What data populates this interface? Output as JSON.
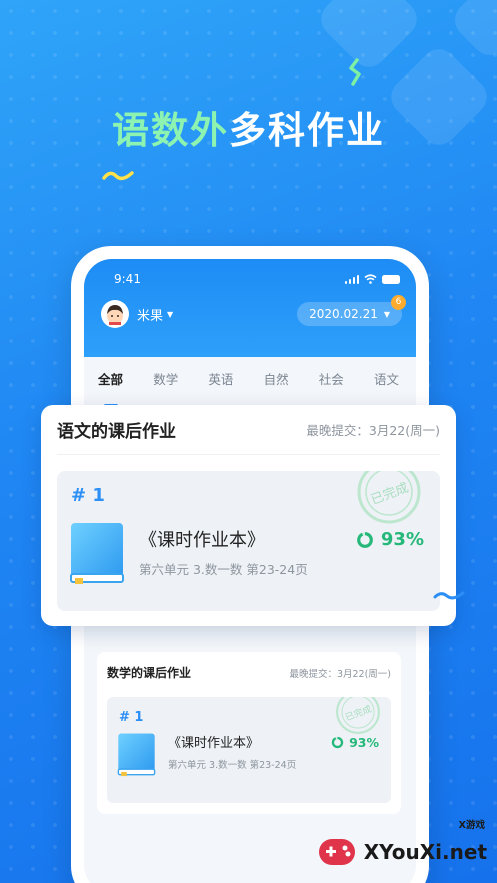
{
  "promo": {
    "headline_accent": "语数外",
    "headline_rest": "多科作业"
  },
  "status_bar": {
    "time": "9:41"
  },
  "header": {
    "user_name": "米果",
    "date": "2020.02.21",
    "notification_count": "6"
  },
  "tabs": [
    {
      "label": "全部",
      "active": true
    },
    {
      "label": "数学",
      "active": false
    },
    {
      "label": "英语",
      "active": false
    },
    {
      "label": "自然",
      "active": false
    },
    {
      "label": "社会",
      "active": false
    },
    {
      "label": "语文",
      "active": false
    }
  ],
  "featured_card": {
    "title": "语文的课后作业",
    "deadline": "最晚提交：3月22(周一)",
    "item": {
      "number": "# 1",
      "name": "《课时作业本》",
      "detail": "第六单元 3.数一数 第23-24页",
      "progress": "93%",
      "progress_value": 0.93,
      "stamp_text": "已完成"
    }
  },
  "secondary_card": {
    "title": "数学的课后作业",
    "deadline": "最晚提交：3月22(周一)",
    "item": {
      "number": "# 1",
      "name": "《课时作业本》",
      "detail": "第六单元 3.数一数 第23-24页",
      "progress": "93%",
      "progress_value": 0.93,
      "stamp_text": "已完成"
    }
  },
  "watermark": {
    "site": "XYouXi.net",
    "tag": "X游戏"
  },
  "colors": {
    "primary": "#2b8ff6",
    "success": "#26b87a",
    "accent_text": "#8df3b0",
    "badge": "#ffab2e"
  }
}
